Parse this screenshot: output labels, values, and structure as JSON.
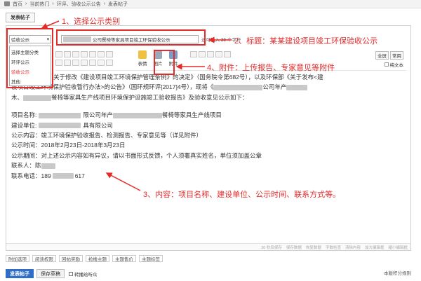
{
  "breadcrumb": [
    "首页",
    "当前热门",
    "环评、验收公示公告",
    "发表帖子"
  ],
  "tab": "发表帖子",
  "category": {
    "selected": "验收公示",
    "options": [
      "选择主题分类",
      "环评公示",
      "验收公示",
      "其他"
    ]
  },
  "title": {
    "value": "公司餐椅等家具项目竣工环保验收公示",
    "counter_prefix": "还可输入",
    "counter_num": "30",
    "counter_suffix": "个字符"
  },
  "toolbar": {
    "emoji": "表情",
    "image": "图片",
    "attachment": "附件",
    "full": "全屏",
    "common": "常用",
    "plain": "纯文本"
  },
  "content": {
    "p1a": "关于修改《建设项目竣工环境保护管理条例》的决定》（国务院令第682号），以及环保部《关于发布<建",
    "p1b": "设项目竣工环境保护验收暂行办法>的公告》（国环规环评[2017]4号），现将《",
    "p1b2": "公司年产",
    "p1c1": "木、",
    "p1c2": "餐椅等家具生产线项目环境保护设施竣工验收报告》及验收意见公示如下：",
    "l1a": "项目名称:",
    "l1b": "限公司年产",
    "l1c": "餐椅等家具生产线项目",
    "l2a": "建设单位:",
    "l2b": "具有限公司",
    "l3": "公示内容：竣工环境保护验收报告、检测报告、专家意见等（详见附件）",
    "l4": "公示时间：2018年2月23日-2018年3月23日",
    "l5": "公示期间：对上述公示内容如有异议，请以书面形式反馈，个人须署真实姓名，单位须加盖公章",
    "l6": "联系人：陈",
    "l7a": "联系电话：189",
    "l7b": "617"
  },
  "status": [
    "30 秒后保存",
    "保存数据",
    "恢复数据",
    "字数检查",
    "清除内容",
    "加大编辑框",
    "缩小编辑框"
  ],
  "options": [
    "附加选项",
    "阅读权限",
    "回帖奖励",
    "抢楼主题",
    "主题售价",
    "主题标签"
  ],
  "submit_label": "发表帖子",
  "draft_label": "保存草稿",
  "sync_label": "转播给听众",
  "rules_label": "本版积分规则",
  "annotations": {
    "a1": "1、选择公示类别",
    "a2": "2、标题：某某建设项目竣工环保验收公示",
    "a3": "3、内容：项目名称、建设单位、公示时间、联系方式等。",
    "a4": "4、附件：上传报告、专家意见等附件"
  },
  "colors": {
    "annotation": "#e52a2a",
    "submit": "#2f6dc6"
  }
}
